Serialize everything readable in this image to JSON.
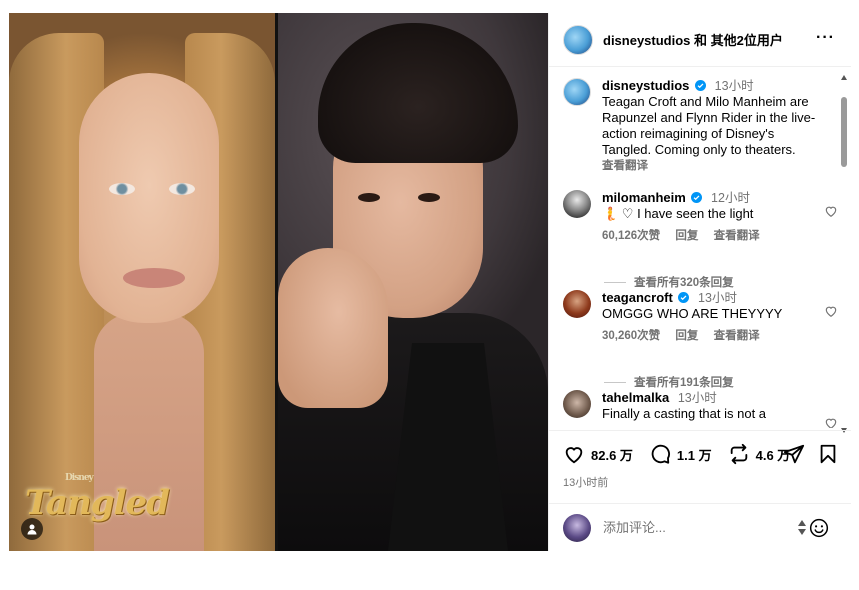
{
  "media": {
    "logo_text": "Tangled",
    "logo_brand": "Disney"
  },
  "header": {
    "title": "disneystudios 和 其他2位用户",
    "more_label": "···"
  },
  "caption": {
    "username": "disneystudios",
    "time": "13小时",
    "text": "Teagan Croft and Milo Manheim are Rapunzel and Flynn Rider in the live-action reimagining of Disney's Tangled. Coming only to theaters.",
    "translate": "查看翻译"
  },
  "comments": [
    {
      "username": "milomanheim",
      "time": "12小时",
      "text": "🧜 ♡ I have seen the light",
      "likes": "60,126次赞",
      "reply": "回复",
      "translate": "查看翻译",
      "view_replies": "查看所有320条回复"
    },
    {
      "username": "teagancroft",
      "time": "13小时",
      "text": "OMGGG WHO ARE THEYYYY",
      "likes": "30,260次赞",
      "reply": "回复",
      "translate": "查看翻译",
      "view_replies": "查看所有191条回复"
    },
    {
      "username": "tahelmalka",
      "time": "13小时",
      "text": "Finally a casting that is not a"
    }
  ],
  "actions": {
    "likes": "82.6 万",
    "comments": "1.1 万",
    "shares": "4.6 万",
    "post_time": "13小时前"
  },
  "composer": {
    "placeholder": "添加评论..."
  },
  "colors": {
    "verified": "#0095f6",
    "muted": "#737373",
    "border": "#efefef"
  }
}
